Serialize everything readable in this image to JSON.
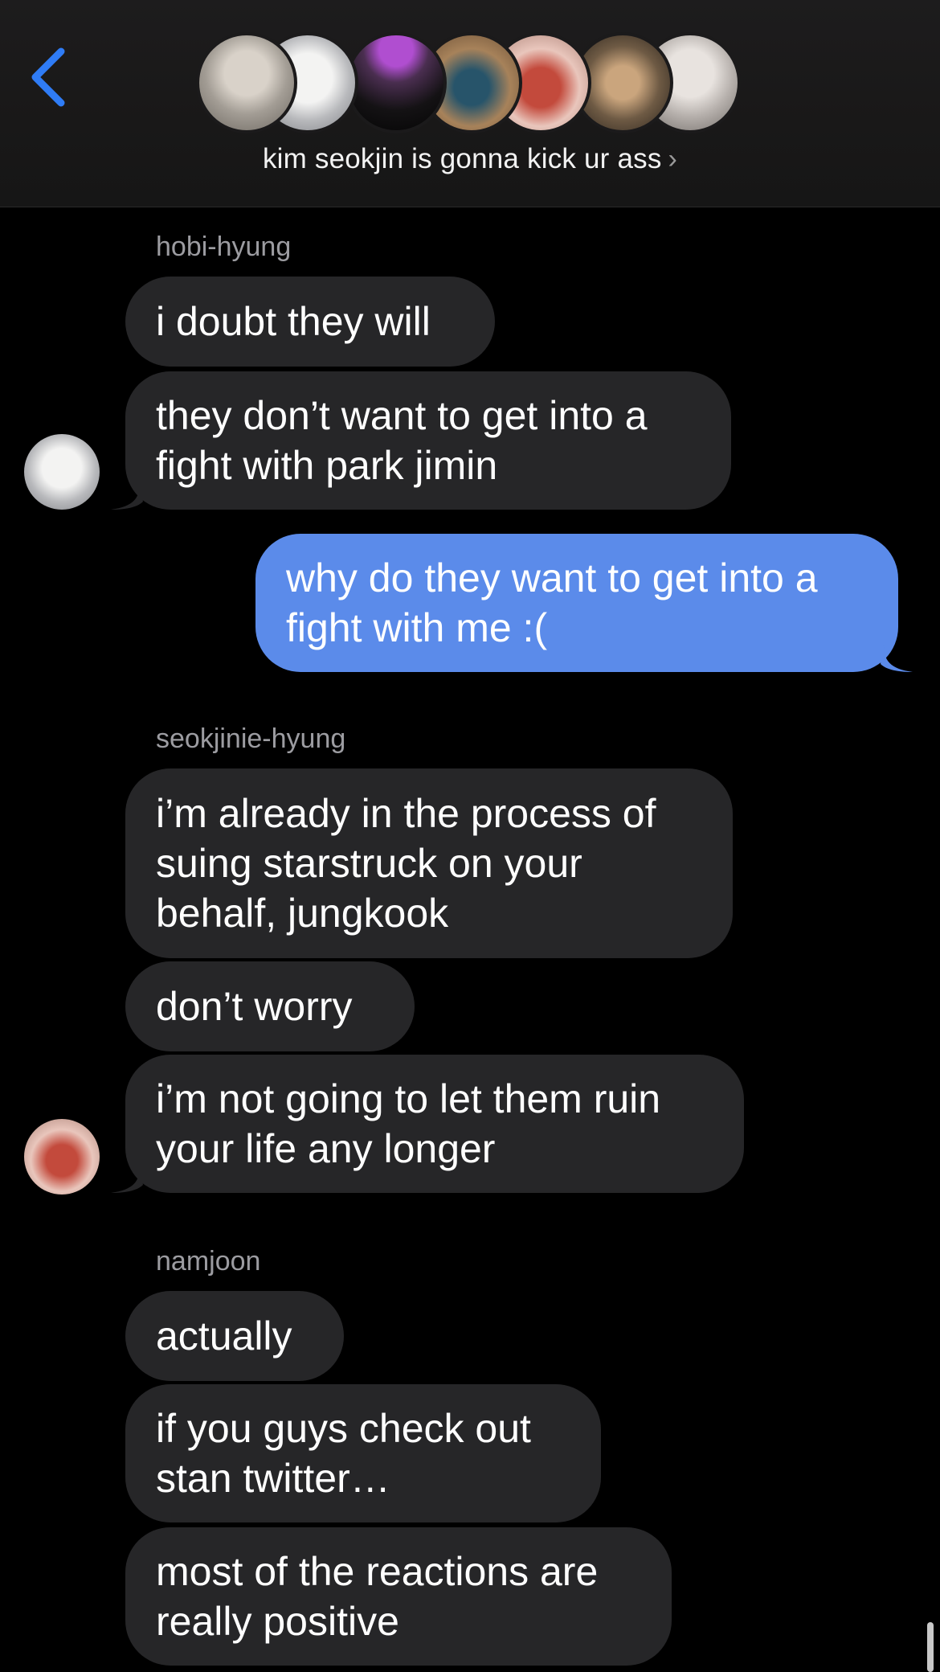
{
  "header": {
    "back_icon": "chevron-left-icon",
    "title": "kim seokjin is gonna kick ur ass",
    "title_chevron": "›",
    "accent": "#2f7cf6"
  },
  "messages": {
    "group1": {
      "sender": "hobi-hyung",
      "b1": "i doubt they will",
      "b2": "they don’t want to get into a fight with park jimin"
    },
    "outgoing": {
      "b1": "why do they want to get into a fight with me :("
    },
    "group2": {
      "sender": "seokjinie-hyung",
      "b1": "i’m already in the process of suing starstruck on your behalf, jungkook",
      "b2": "don’t worry",
      "b3": "i’m not going to let them ruin your life any longer"
    },
    "group3": {
      "sender": "namjoon",
      "b1": "actually",
      "b2": "if you guys check out stan twitter…",
      "b3": "most of the reactions are really positive"
    }
  },
  "colors": {
    "incoming_bubble": "#262628",
    "outgoing_bubble": "#5b8bea",
    "background": "#000000"
  }
}
